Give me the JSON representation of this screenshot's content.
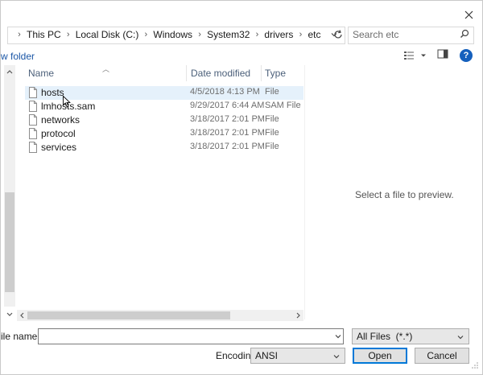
{
  "address_bar": {
    "breadcrumbs": [
      "This PC",
      "Local Disk (C:)",
      "Windows",
      "System32",
      "drivers",
      "etc"
    ],
    "search_placeholder": "Search etc"
  },
  "toolbar": {
    "new_folder_label": "w folder",
    "help_label": "?"
  },
  "file_list": {
    "columns": [
      "Name",
      "Date modified",
      "Type"
    ],
    "rows": [
      {
        "name": "hosts",
        "date": "4/5/2018 4:13 PM",
        "type": "File",
        "selected": true
      },
      {
        "name": "lmhosts.sam",
        "date": "9/29/2017 6:44 AM",
        "type": "SAM File",
        "selected": false
      },
      {
        "name": "networks",
        "date": "3/18/2017 2:01 PM",
        "type": "File",
        "selected": false
      },
      {
        "name": "protocol",
        "date": "3/18/2017 2:01 PM",
        "type": "File",
        "selected": false
      },
      {
        "name": "services",
        "date": "3/18/2017 2:01 PM",
        "type": "File",
        "selected": false
      }
    ]
  },
  "preview": {
    "empty_text": "Select a file to preview."
  },
  "bottom": {
    "file_name_label": "ile name:",
    "file_name_value": "",
    "filter_value": "All Files  (*.*)",
    "encoding_label": "Encoding:",
    "encoding_value": "ANSI",
    "open_label": "Open",
    "cancel_label": "Cancel"
  },
  "colors": {
    "accent": "#0078d7",
    "selection": "#e5f1fb",
    "link": "#1a56a6",
    "column_header": "#4c607a"
  }
}
